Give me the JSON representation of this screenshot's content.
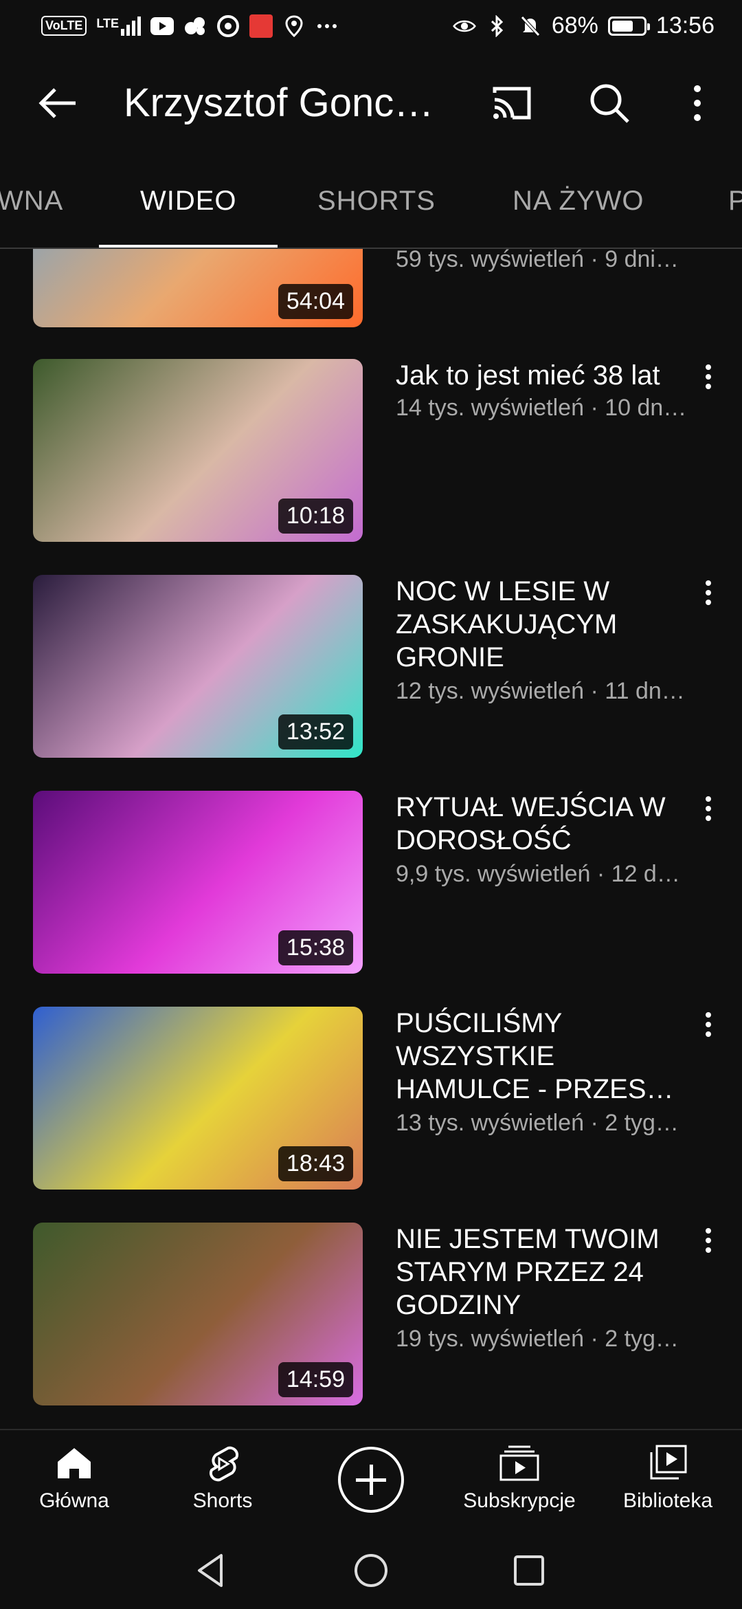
{
  "status_bar": {
    "left_icons": [
      "volte-icon",
      "lte-signal-icon",
      "youtube-icon",
      "app-icon",
      "chrome-icon",
      "red-app-icon",
      "location-icon",
      "more-dots-icon"
    ],
    "volte": "VoLTE",
    "lte": "LTE",
    "battery_percent": "68%",
    "battery_level": 0.68,
    "time": "13:56"
  },
  "app_bar": {
    "title": "Krzysztof Gonc…"
  },
  "tabs": [
    {
      "label": "WNA",
      "active": false
    },
    {
      "label": "WIDEO",
      "active": true
    },
    {
      "label": "SHORTS",
      "active": false
    },
    {
      "label": "NA ŻYWO",
      "active": false
    },
    {
      "label": "P",
      "active": false
    }
  ],
  "videos": [
    {
      "title": "",
      "meta": "59 tys. wyświetleń · 9 dni…",
      "duration": "54:04",
      "colors": [
        "#6fa2c9",
        "#e9a870",
        "#ff6a2b"
      ]
    },
    {
      "title": "Jak to jest mieć 38 lat",
      "meta": "14 tys. wyświetleń · 10 dn…",
      "duration": "10:18",
      "colors": [
        "#3d5a2c",
        "#d9b8a6",
        "#c36bd1"
      ]
    },
    {
      "title": "NOC W LESIE W ZASKAKUJĄCYM GRONIE",
      "meta": "12 tys. wyświetleń · 11 dn…",
      "duration": "13:52",
      "colors": [
        "#2a1d3d",
        "#d6a0c8",
        "#30e6c8"
      ]
    },
    {
      "title": "RYTUAŁ WEJŚCIA W DOROSŁOŚĆ",
      "meta": "9,9 tys. wyświetleń · 12 d…",
      "duration": "15:38",
      "colors": [
        "#5b0d7a",
        "#e23ad9",
        "#f3a0ff"
      ]
    },
    {
      "title": "PUŚCILIŚMY WSZYSTKIE HAMULCE - PRZES…",
      "meta": "13 tys. wyświetleń · 2 tyg…",
      "duration": "18:43",
      "colors": [
        "#2f5fd1",
        "#e6d23a",
        "#d97b56"
      ]
    },
    {
      "title": "NIE JESTEM TWOIM STARYM PRZEZ 24 GODZINY",
      "meta": "19 tys. wyświetleń · 2 tyg…",
      "duration": "14:59",
      "colors": [
        "#3f5a2c",
        "#8f5e3a",
        "#d86de3"
      ]
    }
  ],
  "bottom_nav": {
    "home": "Główna",
    "shorts": "Shorts",
    "subscriptions": "Subskrypcje",
    "library": "Biblioteka"
  }
}
